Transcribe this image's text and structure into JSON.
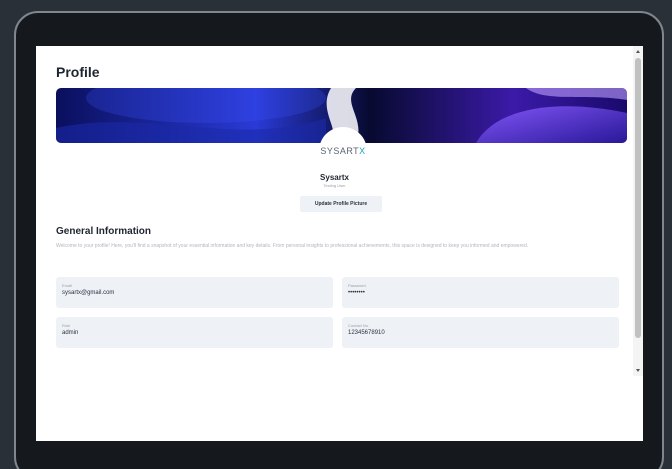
{
  "page": {
    "title": "Profile"
  },
  "brand": {
    "logo_main": "SYSART",
    "logo_accent": "X",
    "accent_color": "#19a7b4"
  },
  "profile": {
    "name": "Sysartx",
    "role_label": "Testing User",
    "update_button": "Update Profile Picture"
  },
  "general": {
    "title": "General Information",
    "description": "Welcome to your profile! Here, you'll find a snapshot of your essential information and key details. From personal insights to professional achievements, this space is designed to keep you informed and empowered."
  },
  "fields": {
    "email": {
      "label": "Email",
      "value": "sysartx@gmail.com"
    },
    "password": {
      "label": "Password",
      "value": "••••••••"
    },
    "role": {
      "label": "Role",
      "value": "admin"
    },
    "contact": {
      "label": "Contact No.",
      "value": "12345678910"
    }
  }
}
